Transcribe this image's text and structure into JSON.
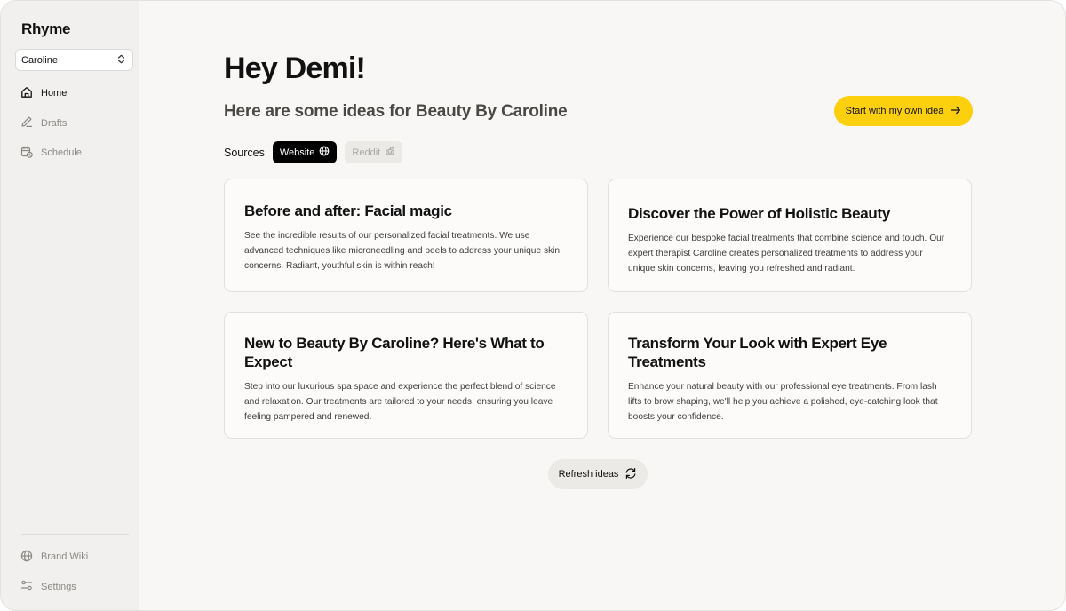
{
  "app": {
    "name": "Rhyme"
  },
  "account": {
    "selected": "Caroline"
  },
  "nav": {
    "items": [
      {
        "label": "Home",
        "icon": "home-icon",
        "active": true
      },
      {
        "label": "Drafts",
        "icon": "pencil-icon",
        "active": false
      },
      {
        "label": "Schedule",
        "icon": "calendar-clock-icon",
        "active": false
      }
    ],
    "bottom": [
      {
        "label": "Brand Wiki",
        "icon": "globe-icon"
      },
      {
        "label": "Settings",
        "icon": "sliders-icon"
      }
    ]
  },
  "main": {
    "greeting": "Hey Demi!",
    "subtitle": "Here are some ideas for Beauty By Caroline",
    "own_idea_label": "Start with my own idea",
    "sources_label": "Sources",
    "sources": [
      {
        "label": "Website",
        "icon": "globe-icon",
        "active": true
      },
      {
        "label": "Reddit",
        "icon": "reddit-icon",
        "active": false
      }
    ],
    "refresh_label": "Refresh ideas"
  },
  "ideas": [
    {
      "title": "Before and after: Facial magic",
      "body": "See the incredible results of our personalized facial treatments. We use advanced techniques like microneedling and peels to address your unique skin concerns. Radiant, youthful skin is within reach!"
    },
    {
      "title": "Discover the Power of Holistic Beauty",
      "body": "Experience our bespoke facial treatments that combine science and touch. Our expert therapist Caroline creates personalized treatments to address your unique skin concerns, leaving you refreshed and radiant."
    },
    {
      "title": "New to Beauty By Caroline? Here's What to Expect",
      "body": "Step into our luxurious spa space and experience the perfect blend of science and relaxation. Our treatments are tailored to your needs, ensuring you leave feeling pampered and renewed."
    },
    {
      "title": "Transform Your Look with Expert Eye Treatments",
      "body": "Enhance your natural beauty with our professional eye treatments. From lash lifts to brow shaping, we'll help you achieve a polished, eye-catching look that boosts your confidence."
    }
  ],
  "colors": {
    "accent": "#fcd00d",
    "background": "#f8f7f5",
    "sidebar": "#f1f0ee",
    "card": "#fcfbfa",
    "chip_active": "#000000"
  }
}
